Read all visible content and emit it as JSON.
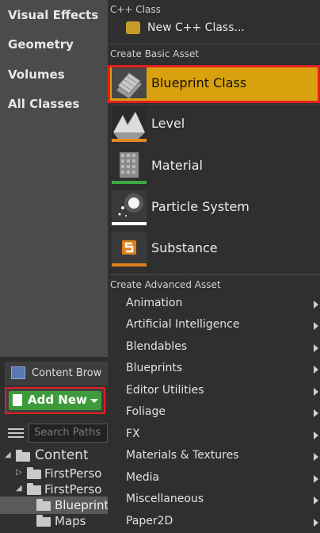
{
  "left_panel": {
    "place_categories": [
      "Visual Effects",
      "Geometry",
      "Volumes",
      "All Classes"
    ],
    "content_browser_tab": "Content Brow",
    "add_new_label": "Add New",
    "search_placeholder": "Search Paths",
    "tree": [
      {
        "label": "Content",
        "depth": 0
      },
      {
        "label": "FirstPerso",
        "depth": 1
      },
      {
        "label": "FirstPerso",
        "depth": 1
      },
      {
        "label": "Blueprint",
        "depth": 2,
        "selected": true
      },
      {
        "label": "Maps",
        "depth": 2
      }
    ]
  },
  "menu": {
    "cpp_section": {
      "header": "C++ Class",
      "item_label": "New C++ Class..."
    },
    "basic_section": {
      "header": "Create Basic Asset",
      "items": [
        {
          "label": "Blueprint Class",
          "icon": "blueprint-class-icon",
          "highlighted": true,
          "strip_color": "#d9a10e"
        },
        {
          "label": "Level",
          "icon": "level-icon",
          "strip_color": "#e08a1e"
        },
        {
          "label": "Material",
          "icon": "material-icon",
          "strip_color": "#3fa83f"
        },
        {
          "label": "Particle System",
          "icon": "particle-system-icon",
          "strip_color": "#ffffff"
        },
        {
          "label": "Substance",
          "icon": "substance-icon",
          "strip_color": "#e07f1d"
        }
      ]
    },
    "advanced_section": {
      "header": "Create Advanced Asset",
      "items": [
        {
          "label": "Animation"
        },
        {
          "label": "Artificial Intelligence"
        },
        {
          "label": "Blendables"
        },
        {
          "label": "Blueprints"
        },
        {
          "label": "Editor Utilities"
        },
        {
          "label": "Foliage"
        },
        {
          "label": "FX"
        },
        {
          "label": "Materials & Textures"
        },
        {
          "label": "Media"
        },
        {
          "label": "Miscellaneous"
        },
        {
          "label": "Paper2D"
        }
      ]
    }
  },
  "colors": {
    "highlight": "#d9a10e",
    "outline_red": "#e02020",
    "add_new_green": "#3e9b3c",
    "menu_bg": "#2f2f2f"
  }
}
